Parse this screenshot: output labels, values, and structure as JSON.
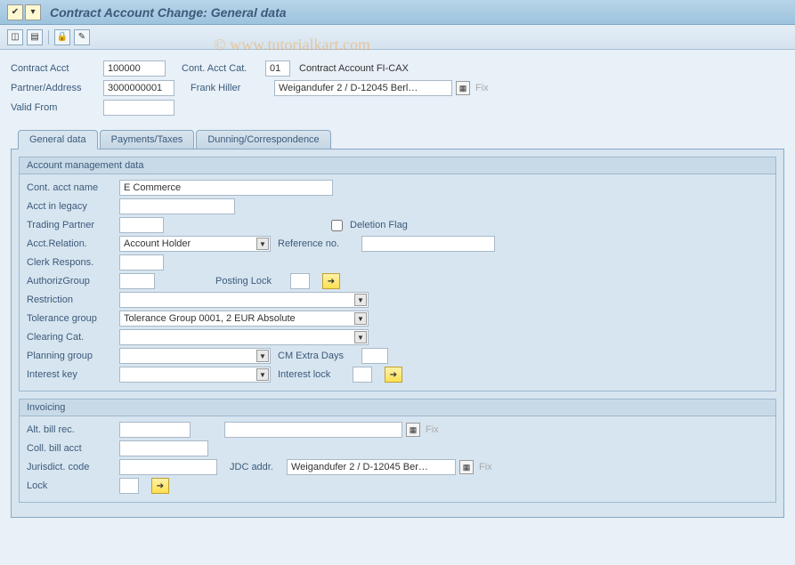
{
  "title": "Contract Account Change: General data",
  "watermark": "© www.tutorialkart.com",
  "header": {
    "contract_acct_label": "Contract Acct",
    "contract_acct_value": "100000",
    "cont_acct_cat_label": "Cont. Acct Cat.",
    "cont_acct_cat_value": "01",
    "cont_acct_cat_desc": "Contract Account FI-CAX",
    "partner_label": "Partner/Address",
    "partner_value": "3000000001",
    "partner_name": "Frank Hiller",
    "partner_addr": "Weigandufer 2 / D-12045 Berl…",
    "fix_label": "Fix",
    "valid_from_label": "Valid From",
    "valid_from_value": ""
  },
  "tabs": {
    "t1": "General data",
    "t2": "Payments/Taxes",
    "t3": "Dunning/Correspondence"
  },
  "group1": {
    "title": "Account management data",
    "cont_acct_name_label": "Cont. acct name",
    "cont_acct_name_value": "E Commerce",
    "acct_legacy_label": "Acct in legacy",
    "acct_legacy_value": "",
    "trading_partner_label": "Trading Partner",
    "trading_partner_value": "",
    "deletion_flag_label": "Deletion Flag",
    "acct_relation_label": "Acct.Relation.",
    "acct_relation_value": "Account Holder",
    "reference_no_label": "Reference no.",
    "reference_no_value": "",
    "clerk_label": "Clerk Respons.",
    "clerk_value": "",
    "authgrp_label": "AuthorizGroup",
    "authgrp_value": "",
    "posting_lock_label": "Posting Lock",
    "posting_lock_value": "",
    "restriction_label": "Restriction",
    "restriction_value": "",
    "tolerance_label": "Tolerance group",
    "tolerance_value": "Tolerance Group 0001, 2 EUR Absolute",
    "clearing_label": "Clearing Cat.",
    "clearing_value": "",
    "planning_label": "Planning group",
    "planning_value": "",
    "cm_extra_label": "CM Extra Days",
    "cm_extra_value": "",
    "interest_key_label": "Interest key",
    "interest_key_value": "",
    "interest_lock_label": "Interest lock",
    "interest_lock_value": ""
  },
  "group2": {
    "title": "Invoicing",
    "alt_bill_label": "Alt. bill rec.",
    "alt_bill_value": "",
    "alt_bill_addr": "",
    "fix_label": "Fix",
    "coll_bill_label": "Coll. bill acct",
    "coll_bill_value": "",
    "jurisdict_label": "Jurisdict. code",
    "jurisdict_value": "",
    "jdc_addr_label": "JDC addr.",
    "jdc_addr_value": "Weigandufer 2 / D-12045 Ber…",
    "lock_label": "Lock",
    "lock_value": ""
  }
}
